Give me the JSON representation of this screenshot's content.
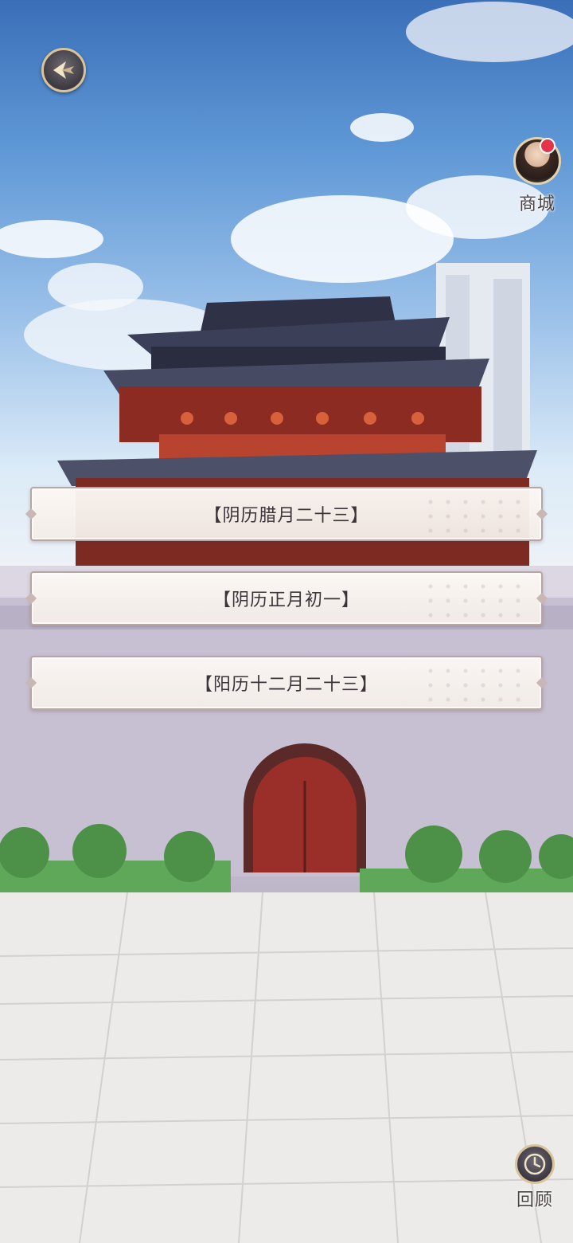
{
  "nav": {
    "back_icon": "back-arrow-icon",
    "shop_label": "商城",
    "review_label": "回顾"
  },
  "choices": [
    {
      "label": "【阴历腊月二十三】"
    },
    {
      "label": "【阴历正月初一】"
    },
    {
      "label": "【阳历十二月二十三】"
    }
  ],
  "colors": {
    "notification_dot": "#e3344a",
    "frame_gold": "#d8c39a",
    "choice_border": "#b9a6a2"
  }
}
